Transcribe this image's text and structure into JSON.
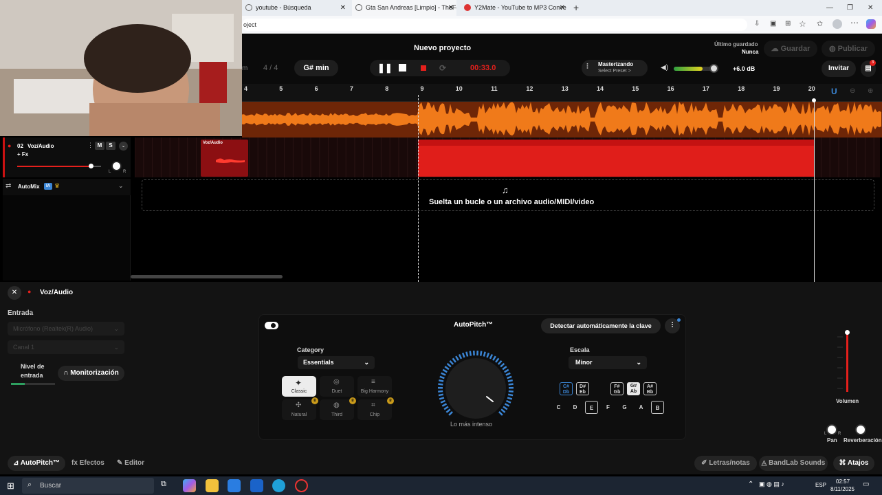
{
  "browser": {
    "tabs": [
      {
        "label": "youtube - Búsqueda"
      },
      {
        "label": "Gta San Andreas [Limpio] - TheFe"
      },
      {
        "label": "Y2Mate - YouTube to MP3 Conve"
      }
    ],
    "new_tab": "+",
    "address_text": "oject",
    "window_controls": [
      "—",
      "❐",
      "✕"
    ]
  },
  "daw": {
    "project_title": "Nuevo proyecto",
    "last_saved_label": "Último guardado",
    "last_saved_value": "Nunca",
    "save_label": "Guardar",
    "publish_label": "Publicar",
    "invite_label": "Invitar",
    "notif_count": "3",
    "time_sig_prefix": "m",
    "time_sig": "4 / 4",
    "key": "G# min",
    "timer": "00:33.0",
    "mastering_title": "Masterizando",
    "mastering_preset": "Select Preset >",
    "master_volume_db": "+6.0 dB",
    "master_volume_level": 0.7,
    "ruler_ticks": [
      "4",
      "5",
      "6",
      "7",
      "8",
      "9",
      "10",
      "11",
      "12",
      "13",
      "14",
      "15",
      "16",
      "17",
      "18",
      "19",
      "20"
    ],
    "track": {
      "number": "02",
      "name": "Voz/Audio",
      "mute": "M",
      "solo": "S",
      "fx": "+ Fx",
      "clip_label": "Voz/Audio",
      "pan_l": "L",
      "pan_r": "R",
      "volume_level": 0.88
    },
    "automix_label": "AutoMix",
    "automix_badge": "IA",
    "drop_text": "Suelta un bucle o un archivo audio/MIDI/video"
  },
  "panel": {
    "track_name": "Voz/Audio",
    "input_label": "Entrada",
    "input_device": "Micrófono (Realtek(R) Audio)",
    "input_channel": "Canal 1",
    "input_level_label_1": "Nivel de",
    "input_level_label_2": "entrada",
    "monitor_label": "Monitorización",
    "autopitch_title": "AutoPitch™",
    "detect_key_label": "Detectar automáticamente la clave",
    "category_label": "Category",
    "category_value": "Essentials",
    "styles": [
      "Classic",
      "Duet",
      "Big Harmony",
      "Natural",
      "Third",
      "Chip"
    ],
    "selected_style": "Classic",
    "knob_caption": "Lo más intenso",
    "scale_label": "Escala",
    "scale_value": "Minor",
    "sharp_keys": [
      {
        "top": "C#",
        "bottom": "Db"
      },
      {
        "top": "D#",
        "bottom": "Eb"
      },
      {
        "top": "F#",
        "bottom": "Gb"
      },
      {
        "top": "G#",
        "bottom": "Ab"
      },
      {
        "top": "A#",
        "bottom": "Bb"
      }
    ],
    "natural_keys": [
      "C",
      "D",
      "E",
      "F",
      "G",
      "A",
      "B"
    ],
    "volume_label": "Volumen",
    "pan_label": "Pan",
    "pan_l": "L",
    "pan_r": "R",
    "reverb_label": "Reverberación"
  },
  "footer": {
    "autopitch_tab": "AutoPitch™",
    "effects_tab": "Efectos",
    "editor_tab": "Editor",
    "lyrics_label": "Letras/notas",
    "sounds_label": "BandLab Sounds",
    "shortcuts_label": "Atajos"
  },
  "taskbar": {
    "search_placeholder": "Buscar",
    "lang": "ESP",
    "time": "02:57",
    "date": "8/11/2025"
  },
  "colors": {
    "accent_red": "#e5201c",
    "wave_orange": "#f07a1a",
    "accent_blue": "#3b86d6"
  }
}
